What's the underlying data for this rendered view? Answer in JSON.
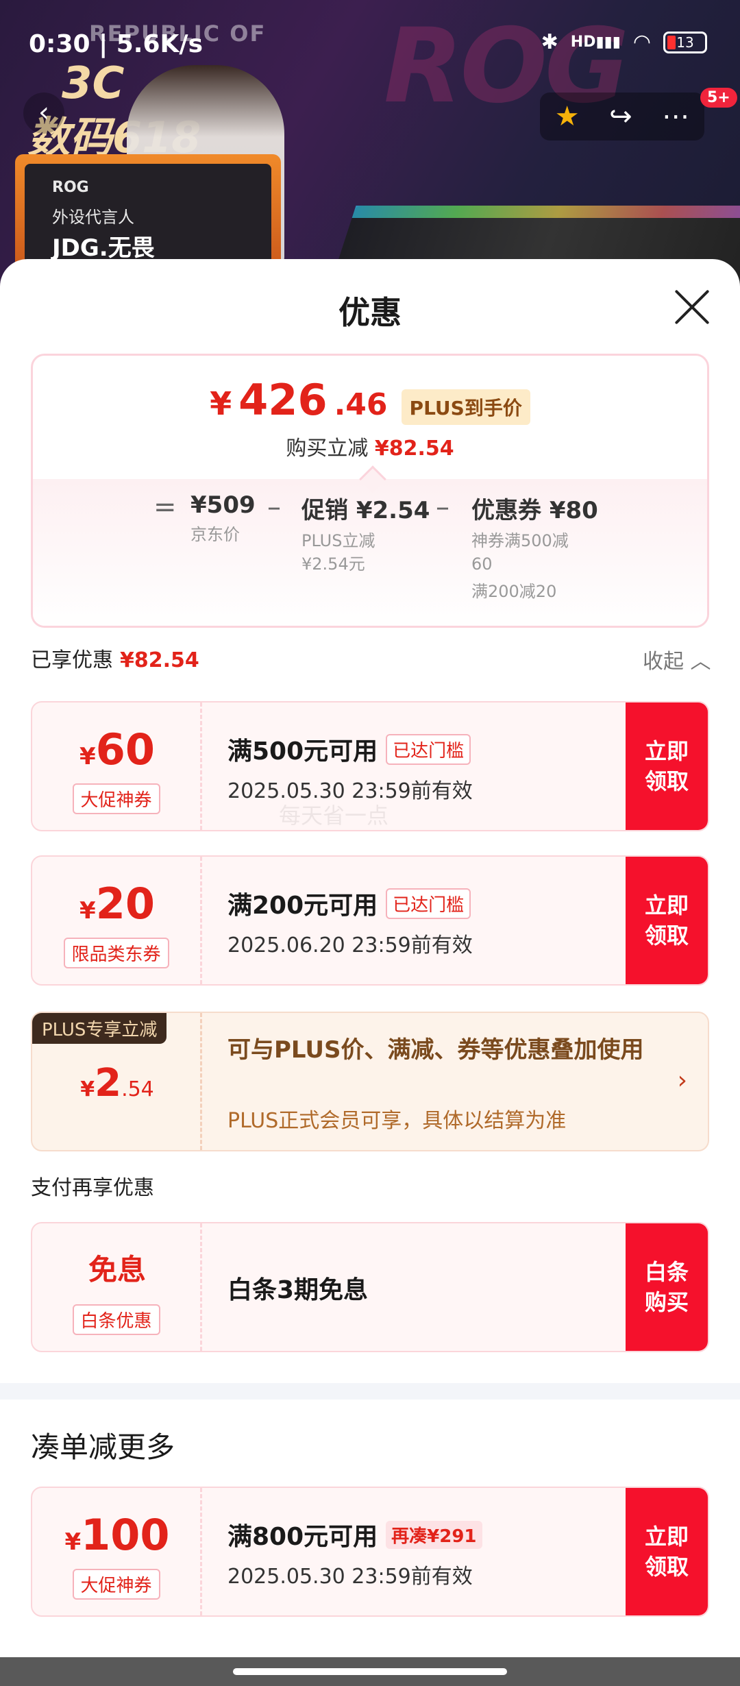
{
  "status_bar": {
    "time": "0:30 | 5.6K/s",
    "signal": "HD",
    "battery": "13"
  },
  "banner": {
    "brand": "REPUBLIC OF",
    "promo_top": "3C",
    "promo_bottom": "数码618",
    "card_line1": "ROG",
    "card_line2": "外设代言人",
    "card_line3": "JDG.无畏",
    "watermark_text": "ROG"
  },
  "nav": {
    "back": "‹",
    "more_badge": "5+"
  },
  "sheet": {
    "title": "优惠"
  },
  "price": {
    "yen": "¥",
    "integer": "426",
    "decimal": ".46",
    "plus_tag": "PLUS到手价",
    "instant_label": "购买立减",
    "instant_value": "¥82.54",
    "eq": "=",
    "minus": "–",
    "jd_value": "¥509",
    "jd_label": "京东价",
    "promo_value": "促销 ¥2.54",
    "promo_sub1": "PLUS立减",
    "promo_sub2": "¥2.54元",
    "coupon_value": "优惠券 ¥80",
    "coupon_sub1": "神券满500减",
    "coupon_sub2": "60",
    "coupon_sub3": "满200减20"
  },
  "enjoyed": {
    "label": "已享优惠",
    "value": "¥82.54",
    "collapse": "收起"
  },
  "coupons": [
    {
      "yen": "¥",
      "amount": "60",
      "tag": "大促神券",
      "condition": "满500元可用",
      "badge": "已达门槛",
      "expire": "2025.05.30 23:59前有效",
      "button": "立即领取"
    },
    {
      "yen": "¥",
      "amount": "20",
      "tag": "限品类东券",
      "condition": "满200元可用",
      "badge": "已达门槛",
      "expire": "2025.06.20 23:59前有效",
      "button": "立即领取"
    }
  ],
  "watermark": "每天省一点",
  "plus": {
    "ribbon": "PLUS专享立减",
    "yen": "¥",
    "amount": "2",
    "decimal": ".54",
    "desc": "可与PLUS价、满减、券等优惠叠加使用",
    "sub": "PLUS正式会员可享，具体以结算为准",
    "arrow": "›"
  },
  "payment": {
    "title": "支付再享优惠",
    "amount": "免息",
    "tag": "白条优惠",
    "text": "白条3期免息",
    "button": "白条购买"
  },
  "more": {
    "title": "凑单减更多",
    "yen": "¥",
    "amount": "100",
    "tag": "大促神券",
    "condition": "满800元可用",
    "badge": "再凑¥291",
    "expire": "2025.05.30 23:59前有效",
    "button": "立即领取"
  }
}
